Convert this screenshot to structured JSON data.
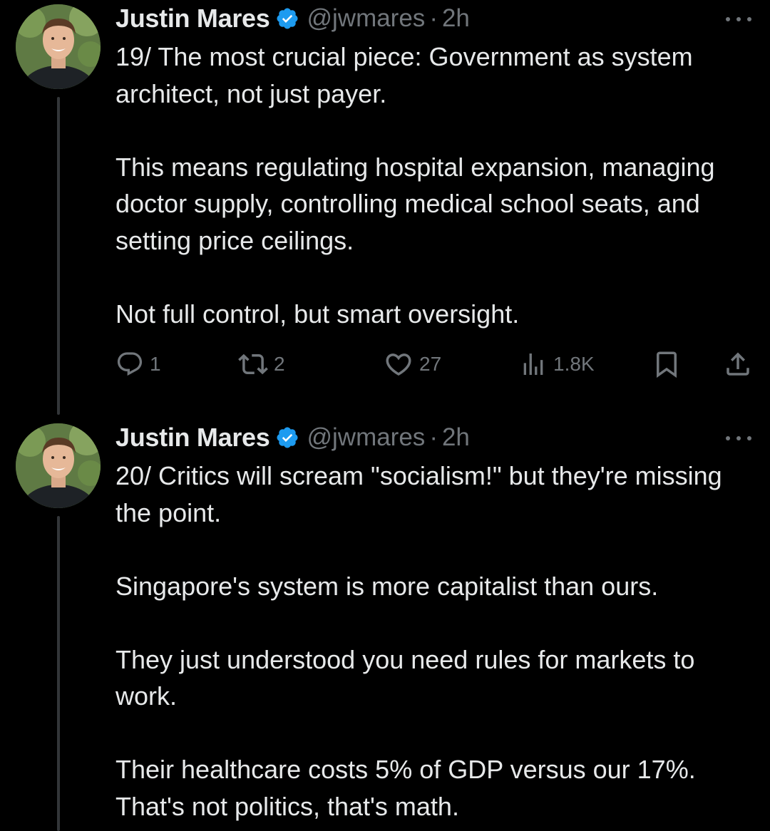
{
  "tweets": [
    {
      "author": {
        "display_name": "Justin Mares",
        "handle": "@jwmares",
        "separator": "·",
        "time": "2h",
        "verified": true
      },
      "paragraphs": [
        "19/ The most crucial piece: Government as system architect, not just payer.",
        "This means regulating hospital expansion, managing doctor supply, controlling medical school seats, and setting price ceilings.",
        "Not full control, but smart oversight."
      ],
      "actions": {
        "replies": "1",
        "retweets": "2",
        "likes": "27",
        "views": "1.8K"
      }
    },
    {
      "author": {
        "display_name": "Justin Mares",
        "handle": "@jwmares",
        "separator": "·",
        "time": "2h",
        "verified": true
      },
      "paragraphs": [
        "20/ Critics will scream \"socialism!\" but they're missing the point.",
        "Singapore's system is more capitalist than ours.",
        "They just understood you need rules for markets to work.",
        "Their healthcare costs 5% of GDP versus our 17%. That's not politics, that's math."
      ]
    }
  ],
  "icons": {
    "more": "more-horizontal-icon",
    "verified": "verified-badge-icon",
    "reply": "reply-icon",
    "retweet": "retweet-icon",
    "like": "heart-icon",
    "views": "views-chart-icon",
    "bookmark": "bookmark-icon",
    "share": "share-icon"
  },
  "colors": {
    "background": "#000000",
    "primary_text": "#e7e9ea",
    "secondary_text": "#71767b",
    "verified_blue": "#1d9bf0",
    "thread_line": "#333639"
  }
}
